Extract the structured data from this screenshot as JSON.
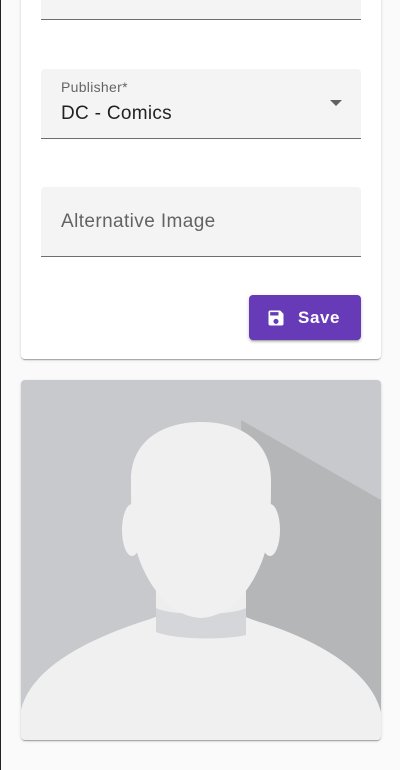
{
  "form": {
    "publisher_label": "Publisher*",
    "publisher_value": "DC - Comics",
    "alternative_image_placeholder": "Alternative Image",
    "save_label": "Save"
  },
  "icons": {
    "save": "floppy-disk-icon",
    "dropdown": "arrow-drop-down-icon",
    "image": "avatar-placeholder-image"
  },
  "colors": {
    "primary": "#673ab7",
    "field_background": "#f4f4f4",
    "placeholder_background": "#c8c9cd"
  }
}
